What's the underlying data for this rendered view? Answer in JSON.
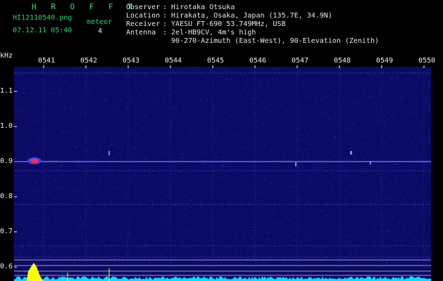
{
  "header": {
    "logo": "H R O F F T",
    "filename": "HI12110540.png",
    "datetime": "07.12.11 05:40",
    "meteor_label": "meteor",
    "meteor_count": "4",
    "observer_label": "Observer",
    "observer_value": ": Hirotaka Otsuka",
    "location_label": "Location",
    "location_value": ": Hirakata, Osaka, Japan (135.7E, 34.9N)",
    "receiver_label": "Receiver",
    "receiver_value": ": YAESU FT-690 53.749MHz, USB",
    "antenna_label": "Antenna",
    "antenna_value": ": 2el-HB9CV, 4m's high",
    "antenna_value2": "90-270-Azimuth (East-West), 90-Elevation (Zenith)"
  },
  "axis": {
    "unit": "kHz",
    "x_ticks": [
      "0541",
      "0542",
      "0543",
      "0544",
      "0545",
      "0546",
      "0547",
      "0548",
      "0549",
      "0550"
    ],
    "y_ticks": [
      "1.1",
      "1.0",
      "0.9",
      "0.8",
      "0.7",
      "0.6"
    ]
  },
  "colors": {
    "background": "#000000",
    "spectrum_bg": "#0b0b66",
    "header_green": "#22d36a",
    "signal_line": "#6a6aff",
    "baseline": "#00e0ff",
    "meteor_hot": "#ff3030",
    "meteor_yellow": "#ffff00"
  }
}
